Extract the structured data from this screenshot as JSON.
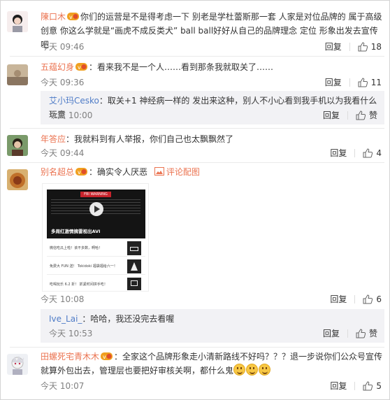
{
  "comments": [
    {
      "username": "陳口木",
      "text": "你们的运营是不是得考虑一下 别老是学杜蕾斯那一套 人家是对位品牌的 属于高级创意 你这么学就是“画虎不成反类犬” ball ball好好从自己的品牌理念 定位 形象出发去宣传吧",
      "time": "今天 09:46",
      "reply_label": "回复",
      "likes": "18"
    },
    {
      "username": "五蕴幻身",
      "text": "：看来我不是一个人……看到那条我就取关了……",
      "time": "今天 09:36",
      "reply_label": "回复",
      "likes": "11",
      "sub_reply": {
        "username": "艾小玛Cesko",
        "text": "：取关+1 神经病一样的 发出来这种，别人不小心看到我手机以为我看什么玩意",
        "time": "今天 10:00",
        "reply_label": "回复",
        "like_label": "赞"
      }
    },
    {
      "username": "年答应",
      "text": "：我就料到有人举报，你们自己也太飘飘然了",
      "time": "今天 09:44",
      "reply_label": "回复",
      "likes": "4"
    },
    {
      "username": "别名超总",
      "text": "：确实令人厌恶",
      "pic_label": "评论配图",
      "time": "今天 10:08",
      "reply_label": "回复",
      "likes": "6",
      "image": {
        "warning": "FBI WARNING",
        "video_title": "多周红激情摘雷视出AVI",
        "rows": [
          "微信吃瓜上啦！该不多数，啊哈！",
          "免费大 FUN 送！ Tokidoki 福袋福给六一！",
          "吃喝玩乐 6.2 折！ 抓紧时间拼手吃！"
        ]
      },
      "sub_reply": {
        "username": "Ive_Lai_",
        "text": "：哈哈，我还没完去看喔",
        "time": "今天 10:53",
        "reply_label": "回复",
        "like_label": "赞"
      }
    },
    {
      "username": "田螺死宅青木木",
      "text": "：全家这个品牌形象走小清新路线不好吗？？？退一步说你们公众号宣传就算外包出去，管理层也要把好审核关啊，都什么鬼",
      "time": "今天 10:07",
      "reply_label": "回复",
      "likes": "5"
    }
  ],
  "colors": {
    "username": "#eb7350",
    "reply_username": "#4f7cc7",
    "reply_bg": "#f2f2f5"
  }
}
